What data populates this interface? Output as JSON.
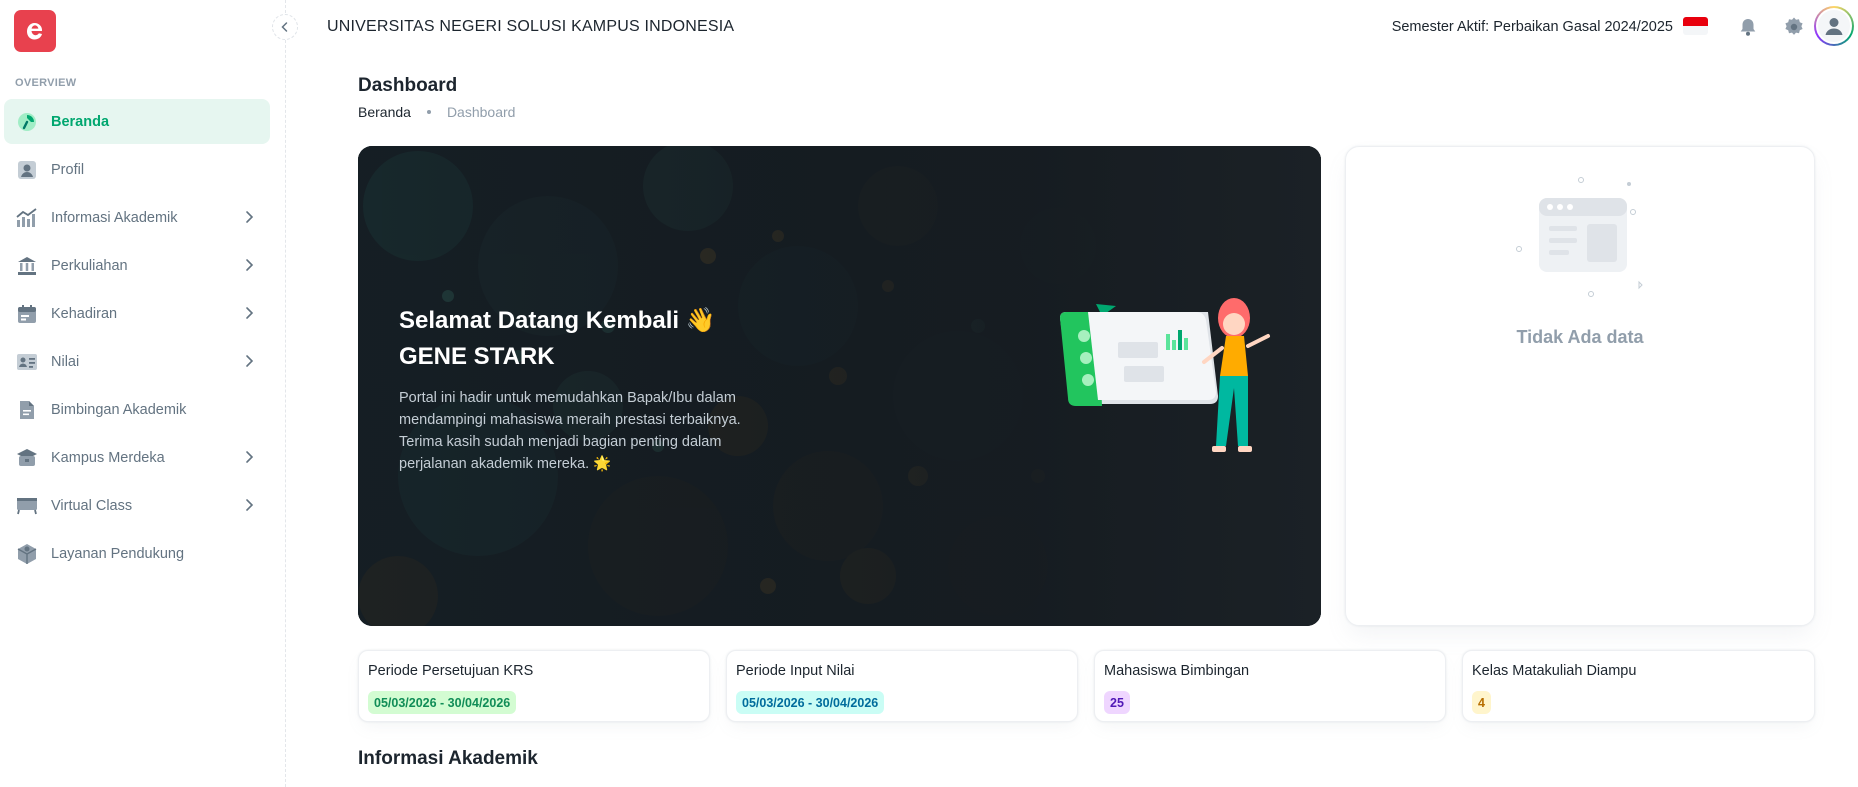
{
  "sidebar": {
    "section_label": "OVERVIEW",
    "items": [
      {
        "label": "Beranda",
        "icon": "dashboard-gauge-icon",
        "active": true,
        "has_submenu": false
      },
      {
        "label": "Profil",
        "icon": "user-profile-icon",
        "active": false,
        "has_submenu": false
      },
      {
        "label": "Informasi Akademik",
        "icon": "chart-trend-icon",
        "active": false,
        "has_submenu": true
      },
      {
        "label": "Perkuliahan",
        "icon": "bank-building-icon",
        "active": false,
        "has_submenu": true
      },
      {
        "label": "Kehadiran",
        "icon": "calendar-icon",
        "active": false,
        "has_submenu": true
      },
      {
        "label": "Nilai",
        "icon": "id-card-icon",
        "active": false,
        "has_submenu": true
      },
      {
        "label": "Bimbingan Akademik",
        "icon": "document-icon",
        "active": false,
        "has_submenu": false
      },
      {
        "label": "Kampus Merdeka",
        "icon": "briefcase-icon",
        "active": false,
        "has_submenu": true
      },
      {
        "label": "Virtual Class",
        "icon": "monitor-icon",
        "active": false,
        "has_submenu": true
      },
      {
        "label": "Layanan Pendukung",
        "icon": "support-box-icon",
        "active": false,
        "has_submenu": false
      }
    ]
  },
  "header": {
    "title": "UNIVERSITAS NEGERI SOLUSI KAMPUS INDONESIA",
    "semester": "Semester Aktif: Perbaikan Gasal 2024/2025",
    "language_flag": "indonesia-flag-icon",
    "icons": [
      "notification-bell-icon",
      "settings-gear-icon",
      "user-avatar-icon"
    ]
  },
  "page": {
    "title": "Dashboard",
    "breadcrumb": [
      "Beranda",
      "Dashboard"
    ]
  },
  "hero": {
    "greeting": "Selamat Datang Kembali 👋",
    "name": "GENE STARK",
    "description": "Portal ini hadir untuk memudahkan Bapak/Ibu dalam mendampingi mahasiswa meraih prestasi terbaiknya. Terima kasih sudah menjadi bagian penting dalam perjalanan akademik mereka. 🌟"
  },
  "empty_state": {
    "text": "Tidak Ada data"
  },
  "stats": [
    {
      "title": "Periode Persetujuan KRS",
      "value": "05/03/2026 - 30/04/2026",
      "color": "#118d57"
    },
    {
      "title": "Periode Input Nilai",
      "value": "05/03/2026 - 30/04/2026",
      "color": "#006c9c"
    },
    {
      "title": "Mahasiswa Bimbingan",
      "value": "25",
      "color": "#5119b7"
    },
    {
      "title": "Kelas Matakuliah Diampu",
      "value": "4",
      "color": "#b76e00"
    }
  ],
  "section": {
    "title": "Informasi Akademik"
  },
  "colors": {
    "brand": "#e8414e",
    "accent": "#00a76f",
    "hero_bg": "#1b2126"
  }
}
